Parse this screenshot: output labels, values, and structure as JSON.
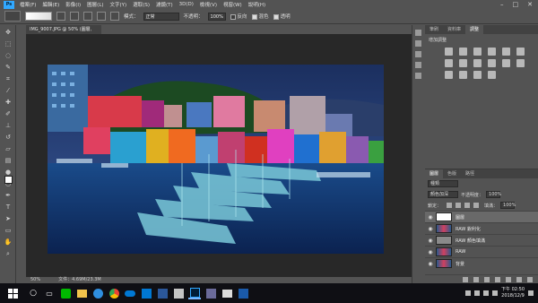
{
  "menubar": {
    "items": [
      "檔案(F)",
      "編輯(E)",
      "影像(I)",
      "圖層(L)",
      "文字(Y)",
      "選取(S)",
      "濾鏡(T)",
      "3D(D)",
      "檢視(V)",
      "視窗(W)",
      "說明(H)"
    ]
  },
  "options": {
    "mode_label": "模式：",
    "mode_value": "正常",
    "opacity_label": "不透明：",
    "opacity_value": "100%",
    "reverse_label": "反向",
    "dither_label": "混色",
    "transparency_label": "透明"
  },
  "document": {
    "tab_title": "IMG_9007.JPG @ 50% (圖層, RGB/8) *",
    "zoom": "50%",
    "file_info": "文件：4.69M/23.3M"
  },
  "adjustments": {
    "tabs": [
      "筆刷",
      "資料庫",
      "調整"
    ],
    "active_tab": "調整",
    "title": "增加調整"
  },
  "layers": {
    "tabs": [
      "圖層",
      "色版",
      "路徑"
    ],
    "filter_label": "種類",
    "blend_mode": "顏色加深",
    "opacity_label": "不透明度：",
    "opacity_value": "100%",
    "lock_label": "鎖定：",
    "fill_label": "填滿：",
    "fill_value": "100%",
    "rows": [
      {
        "name": "圖層",
        "selected": true
      },
      {
        "name": "RAW 銳利化",
        "selected": false
      },
      {
        "name": "RAW 顏色填滿",
        "selected": false
      },
      {
        "name": "RAW",
        "selected": false
      },
      {
        "name": "背景",
        "selected": false
      }
    ]
  },
  "taskbar": {
    "time": "下午 02:50",
    "date": "2018/12/9"
  },
  "colors": {
    "ui_bg": "#535353",
    "canvas_bg": "#282828",
    "taskbar_bg": "#0f0f14",
    "ps_blue": "#31a8ff"
  }
}
